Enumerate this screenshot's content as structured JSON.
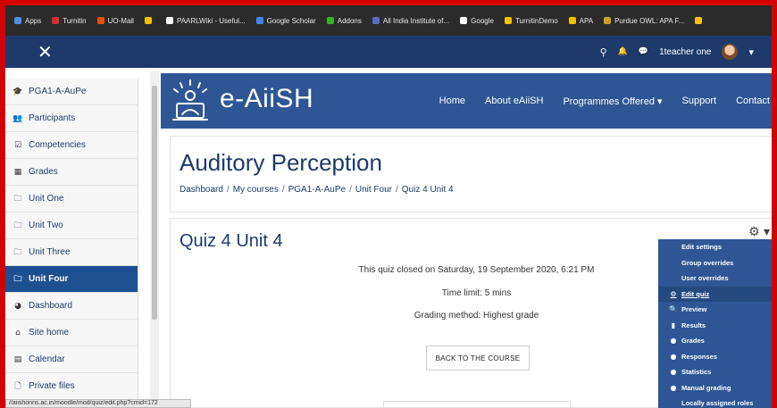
{
  "bookmarks": [
    {
      "label": "Apps",
      "icon": "apps-icon",
      "color": "#4a90e2"
    },
    {
      "label": "Turnitin",
      "icon": "turnitin-icon",
      "color": "#d32f2f"
    },
    {
      "label": "UO-Mail",
      "icon": "mail-icon",
      "color": "#e65100"
    },
    {
      "label": "",
      "icon": "bookmark-icon",
      "color": "#f2c200"
    },
    {
      "label": "PAARLWiki - Useful...",
      "icon": "wiki-icon",
      "color": "#ffffff"
    },
    {
      "label": "Google Scholar",
      "icon": "scholar-icon",
      "color": "#4285f4"
    },
    {
      "label": "Addons",
      "icon": "addons-icon",
      "color": "#3dae2b"
    },
    {
      "label": "All India Institute of...",
      "icon": "aiish-icon",
      "color": "#5c6bc0"
    },
    {
      "label": "Google",
      "icon": "google-icon",
      "color": "#ffffff"
    },
    {
      "label": "TurnitinDemo",
      "icon": "folder-icon",
      "color": "#f2c200"
    },
    {
      "label": "APA",
      "icon": "folder-icon",
      "color": "#f2c200"
    },
    {
      "label": "Purdue OWL: APA F...",
      "icon": "owl-icon",
      "color": "#c9a227"
    },
    {
      "label": "",
      "icon": "bookmark-icon",
      "color": "#f2c200"
    }
  ],
  "navbar": {
    "close_glyph": "✕",
    "user_name": "1teacher one",
    "search_glyph": "⚲",
    "bell_glyph": "🔔",
    "chat_glyph": "💬",
    "caret_glyph": "▾"
  },
  "sidebar": {
    "items": [
      {
        "label": "PGA1-A-AuPe",
        "icon": "graduation-cap-icon",
        "glyph": "🎓",
        "active": false
      },
      {
        "label": "Participants",
        "icon": "users-icon",
        "glyph": "👥",
        "active": false
      },
      {
        "label": "Competencies",
        "icon": "checkbox-icon",
        "glyph": "☑",
        "active": false
      },
      {
        "label": "Grades",
        "icon": "table-icon",
        "glyph": "▦",
        "active": false
      },
      {
        "label": "Unit One",
        "icon": "folder-icon",
        "glyph": "🗀",
        "active": false
      },
      {
        "label": "Unit Two",
        "icon": "folder-icon",
        "glyph": "🗀",
        "active": false
      },
      {
        "label": "Unit Three",
        "icon": "folder-icon",
        "glyph": "🗀",
        "active": false
      },
      {
        "label": "Unit Four",
        "icon": "folder-icon",
        "glyph": "🗀",
        "active": true
      },
      {
        "label": "Dashboard",
        "icon": "dashboard-icon",
        "glyph": "◕",
        "active": false
      },
      {
        "label": "Site home",
        "icon": "home-icon",
        "glyph": "⌂",
        "active": false
      },
      {
        "label": "Calendar",
        "icon": "calendar-icon",
        "glyph": "▤",
        "active": false
      },
      {
        "label": "Private files",
        "icon": "file-icon",
        "glyph": "🗋",
        "active": false
      }
    ]
  },
  "brand": {
    "name": "e-AiiSH",
    "menu": [
      "Home",
      "About eAiiSH",
      "Programmes Offered ▾",
      "Support",
      "Contact"
    ]
  },
  "header": {
    "course_title": "Auditory Perception",
    "breadcrumb": [
      "Dashboard",
      "My courses",
      "PGA1-A-AuPe",
      "Unit Four",
      "Quiz 4 Unit 4"
    ],
    "breadcrumb_sep": "/"
  },
  "quiz": {
    "title": "Quiz 4 Unit 4",
    "closed_text": "This quiz closed on Saturday, 19 September 2020, 6:21 PM",
    "time_limit": "Time limit: 5 mins",
    "grading_method": "Grading method: Highest grade",
    "back_button": "BACK TO THE COURSE",
    "gear_glyph": "⚙ ▾"
  },
  "dropdown": {
    "items": [
      {
        "label": "Edit settings",
        "icon": "",
        "glyph": "",
        "highlight": false
      },
      {
        "label": "Group overrides",
        "icon": "",
        "glyph": "",
        "highlight": false
      },
      {
        "label": "User overrides",
        "icon": "",
        "glyph": "",
        "highlight": false
      },
      {
        "label": "Edit quiz",
        "icon": "gear-icon",
        "glyph": "⚙",
        "highlight": true
      },
      {
        "label": "Preview",
        "icon": "magnifier-icon",
        "glyph": "🔍",
        "highlight": false
      },
      {
        "label": "Results",
        "icon": "bar-chart-icon",
        "glyph": "▮",
        "highlight": false
      },
      {
        "label": "Grades",
        "icon": "circle-icon",
        "glyph": "●",
        "highlight": false
      },
      {
        "label": "Responses",
        "icon": "circle-icon",
        "glyph": "●",
        "highlight": false
      },
      {
        "label": "Statistics",
        "icon": "circle-icon",
        "glyph": "●",
        "highlight": false
      },
      {
        "label": "Manual grading",
        "icon": "circle-icon",
        "glyph": "●",
        "highlight": false
      },
      {
        "label": "Locally assigned roles",
        "icon": "",
        "glyph": "",
        "highlight": false
      }
    ]
  },
  "statusbar": {
    "url": "//aiishonns.ac.in/moodle/mod/quiz/edit.php?cmid=172"
  },
  "colors": {
    "frame": "#d40000",
    "navbar": "#1d3a6b",
    "brand": "#2e5694",
    "active_item": "#1d4f91"
  }
}
